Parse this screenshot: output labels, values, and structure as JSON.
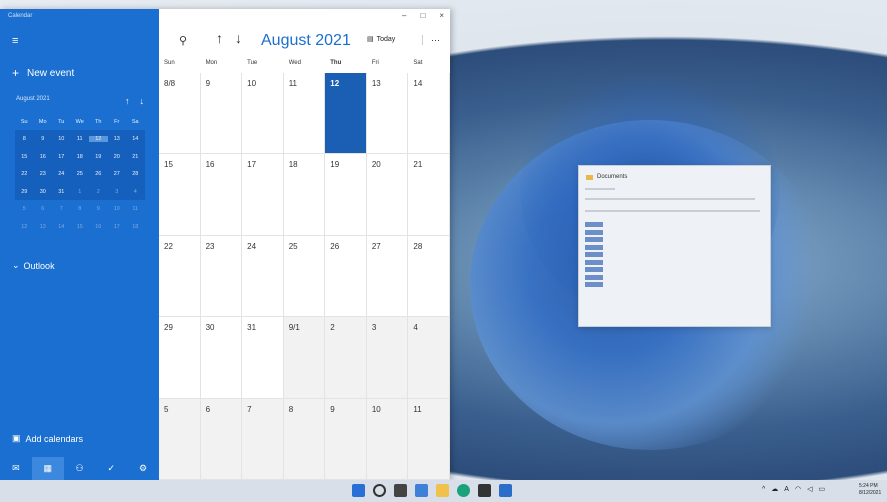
{
  "window": {
    "app_title": "Calendar",
    "controls": {
      "minimize": "–",
      "maximize": "□",
      "close": "×"
    }
  },
  "sidebar": {
    "new_event_label": "New event",
    "mini": {
      "month_label": "August 2021",
      "weekdays": [
        "Su",
        "Mo",
        "Tu",
        "We",
        "Th",
        "Fr",
        "Sa"
      ],
      "weeks": [
        [
          "8",
          "9",
          "10",
          "11",
          "12",
          "13",
          "14"
        ],
        [
          "15",
          "16",
          "17",
          "18",
          "19",
          "20",
          "21"
        ],
        [
          "22",
          "23",
          "24",
          "25",
          "26",
          "27",
          "28"
        ],
        [
          "29",
          "30",
          "31",
          "1",
          "2",
          "3",
          "4"
        ],
        [
          "5",
          "6",
          "7",
          "8",
          "9",
          "10",
          "11"
        ],
        [
          "12",
          "13",
          "14",
          "15",
          "16",
          "17",
          "18"
        ]
      ]
    },
    "outlook_label": "Outlook",
    "add_calendars_label": "Add calendars"
  },
  "header": {
    "month_title": "August 2021",
    "today_label": "Today",
    "more_label": "···"
  },
  "days_of_week": [
    "Sun",
    "Mon",
    "Tue",
    "Wed",
    "Thu",
    "Fri",
    "Sat"
  ],
  "calendar_weeks": [
    [
      "8/8",
      "9",
      "10",
      "11",
      "12",
      "13",
      "14"
    ],
    [
      "15",
      "16",
      "17",
      "18",
      "19",
      "20",
      "21"
    ],
    [
      "22",
      "23",
      "24",
      "25",
      "26",
      "27",
      "28"
    ],
    [
      "29",
      "30",
      "31",
      "9/1",
      "2",
      "3",
      "4"
    ],
    [
      "5",
      "6",
      "7",
      "8",
      "9",
      "10",
      "11"
    ]
  ],
  "documents_window": {
    "title": "Documents"
  },
  "taskbar": {
    "tray_a": "A",
    "clock_time": "5:24 PM",
    "clock_date": "8/12/2021"
  },
  "colors": {
    "accent": "#1a6fd0",
    "today_cell": "#1a5fb4"
  }
}
